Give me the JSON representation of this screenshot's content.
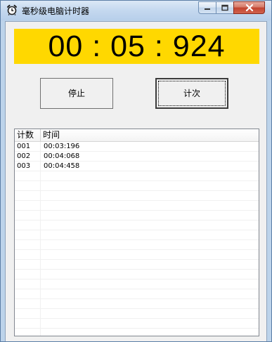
{
  "window": {
    "title": "毫秒级电脑计时器",
    "controls": {
      "minimize": "minimize",
      "maximize": "maximize",
      "close": "close"
    }
  },
  "display": {
    "time": "00:05:924"
  },
  "buttons": {
    "stop_label": "停止",
    "lap_label": "计次"
  },
  "list": {
    "columns": [
      "计数",
      "时间"
    ],
    "rows": [
      [
        "001",
        "00:03:196"
      ],
      [
        "002",
        "00:04:068"
      ],
      [
        "003",
        "00:04:458"
      ],
      [
        "",
        ""
      ],
      [
        "",
        ""
      ],
      [
        "",
        ""
      ],
      [
        "",
        ""
      ],
      [
        "",
        ""
      ],
      [
        "",
        ""
      ],
      [
        "",
        ""
      ],
      [
        "",
        ""
      ],
      [
        "",
        ""
      ],
      [
        "",
        ""
      ],
      [
        "",
        ""
      ],
      [
        "",
        ""
      ],
      [
        "",
        ""
      ],
      [
        "",
        ""
      ],
      [
        "",
        ""
      ],
      [
        "",
        ""
      ],
      [
        "",
        ""
      ]
    ]
  },
  "colors": {
    "display_bg": "#ffd800",
    "close_button": "#c2432f"
  }
}
